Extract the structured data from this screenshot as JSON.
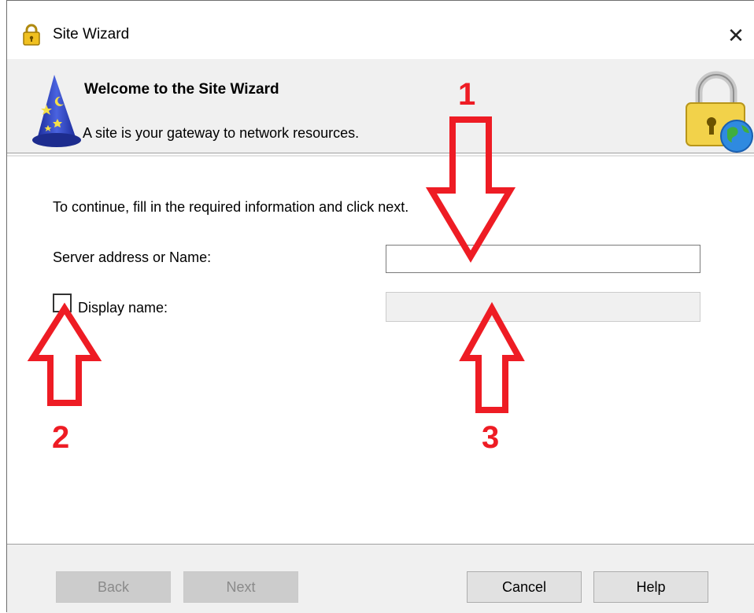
{
  "window": {
    "title": "Site Wizard",
    "close_glyph": "✕",
    "icon": "padlock-icon"
  },
  "header": {
    "title": "Welcome to the Site Wizard",
    "subtitle": "A site is your gateway to network resources.",
    "left_icon": "wizard-hat-icon",
    "right_icon": "lock-globe-icon"
  },
  "form": {
    "intro": "To continue, fill in the required information and click next.",
    "server_label": "Server address or Name:",
    "server_value": "",
    "display_label": "Display name:",
    "display_checked": false,
    "display_value": ""
  },
  "annotations": {
    "color": "#ee1c24",
    "numbers": [
      "1",
      "2",
      "3"
    ]
  },
  "buttons": {
    "back": "Back",
    "next": "Next",
    "cancel": "Cancel",
    "help": "Help"
  }
}
